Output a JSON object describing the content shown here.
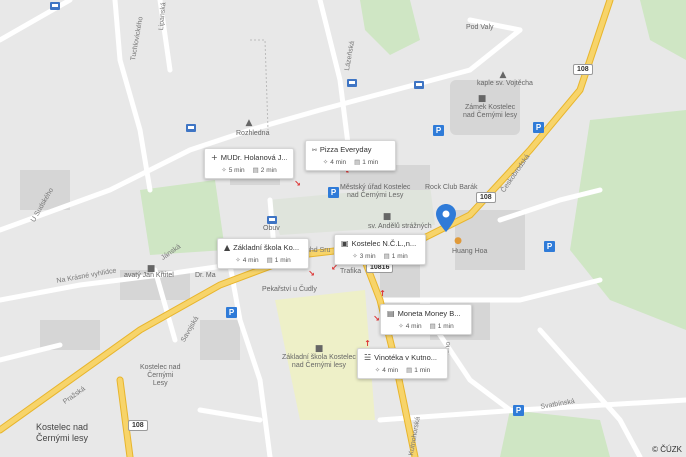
{
  "labels": {
    "pod_valy": "Pod Valy",
    "kaple": "kaple sv. Vojtěcha",
    "zamek": "Zámek Kostelec\nnad Černými lesy",
    "rozhledna": "Rozhledna",
    "mestsky_urad": "Městský úřad Kostelec\nnad Černými Lesy",
    "rock_club": "Rock Club Barák",
    "kostel": "sv. Andělů strážných",
    "huang_hoa": "Huang Hoa",
    "obuv": "Obuv",
    "dr_ma": "Dr. Ma",
    "pekarstvi": "Pekařství u Čudly",
    "zakladni_skola_bldg": "Základní škola Kostelec\nnad Černými lesy",
    "jan_krtitel": "avatý Jan Křtitel",
    "trafika": "Trafika",
    "town": "Kostelec nad\nČernými lesy",
    "kostelec_lesy": "Kostelec nad\nČernými\nLesy"
  },
  "streets": {
    "u_sudsky": "U Sudského",
    "tuchlovického": "Tuchlovického",
    "lipanska": "Lipanská",
    "lazenska": "Lázeňská",
    "na_krasne": "Na Krásné vyhlídce",
    "janska": "Jánská",
    "savojska": "Savojská",
    "prazska": "Pražská",
    "ceskobrodska": "Českobrodská",
    "kostelecka": "Kosteleho",
    "svatbinska": "Svatbínská",
    "kutnohorska": "Kutnohorská",
    "sru": "uhd Sru",
    "prasko": "Prasko"
  },
  "road_numbers": {
    "r108_top": "108",
    "r108_mid": "108",
    "r10816": "10816",
    "r108_bottom": "108"
  },
  "parking": "P",
  "cards": [
    {
      "id": "mudr",
      "icon": "+",
      "name": "MUDr. Holanová J...",
      "walk": "5 min",
      "drive": "2 min"
    },
    {
      "id": "pizza",
      "icon": "⑅",
      "name": "Pizza Everyday",
      "walk": "4 min",
      "drive": "1 min"
    },
    {
      "id": "skola",
      "icon": "▲",
      "name": "Základní škola Ko...",
      "walk": "4 min",
      "drive": "1 min"
    },
    {
      "id": "kostelec",
      "icon": "▣",
      "name": "Kostelec N.Č.L.,n...",
      "walk": "3 min",
      "drive": "1 min"
    },
    {
      "id": "moneta",
      "icon": "▤",
      "name": "Moneta Money B...",
      "walk": "4 min",
      "drive": "1 min"
    },
    {
      "id": "vinoteka",
      "icon": "☱",
      "name": "Vinotéka v Kutno...",
      "walk": "4 min",
      "drive": "1 min"
    }
  ],
  "copyright": "© ČÚZK",
  "colors": {
    "park": "#cfe6c4",
    "road_major": "#f5c842",
    "pin": "#2f7bd8",
    "parking": "#2f7bd8"
  }
}
